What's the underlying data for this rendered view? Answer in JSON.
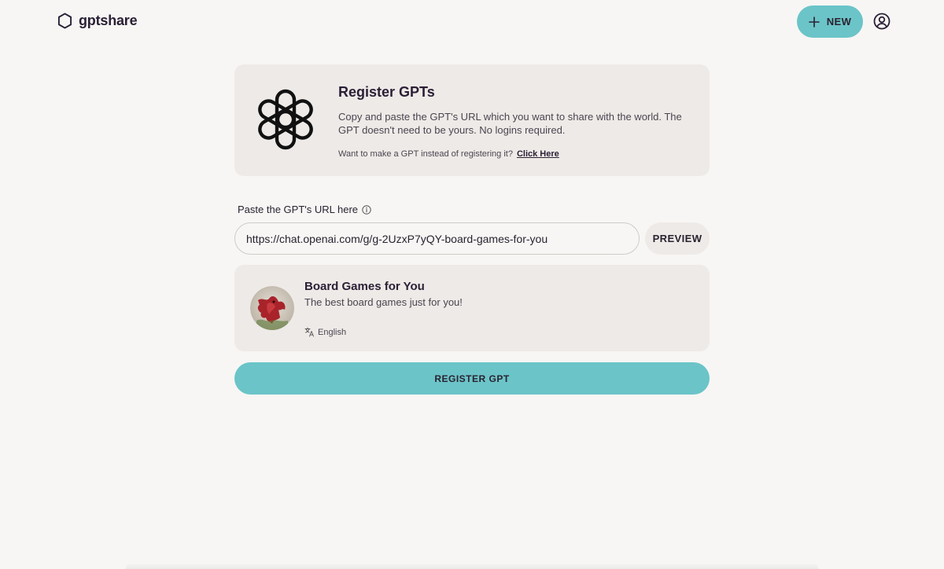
{
  "header": {
    "logo_text": "gptshare",
    "new_button_label": "NEW"
  },
  "register_card": {
    "title": "Register GPTs",
    "description": "Copy and paste the GPT's URL which you want to share with the world. The GPT doesn't need to be yours. No logins required.",
    "make_prompt": "Want to make a GPT instead of registering it?",
    "make_link": "Click Here"
  },
  "url_form": {
    "label": "Paste the GPT's URL here",
    "value": "https://chat.openai.com/g/g-2UzxP7yQY-board-games-for-you",
    "preview_button": "PREVIEW"
  },
  "gpt_preview": {
    "name": "Board Games for You",
    "description": "The best board games just for you!",
    "language": "English"
  },
  "register_button": "REGISTER GPT",
  "colors": {
    "accent": "#6bc4c8",
    "card_bg": "#eeeae7",
    "page_bg": "#f7f6f4",
    "text": "#2a1f35"
  },
  "icons": {
    "logo": "hexagon-icon",
    "new": "plus-icon",
    "user": "user-circle-icon",
    "brand": "openai-logo-icon",
    "info": "info-icon",
    "language": "translate-icon"
  }
}
